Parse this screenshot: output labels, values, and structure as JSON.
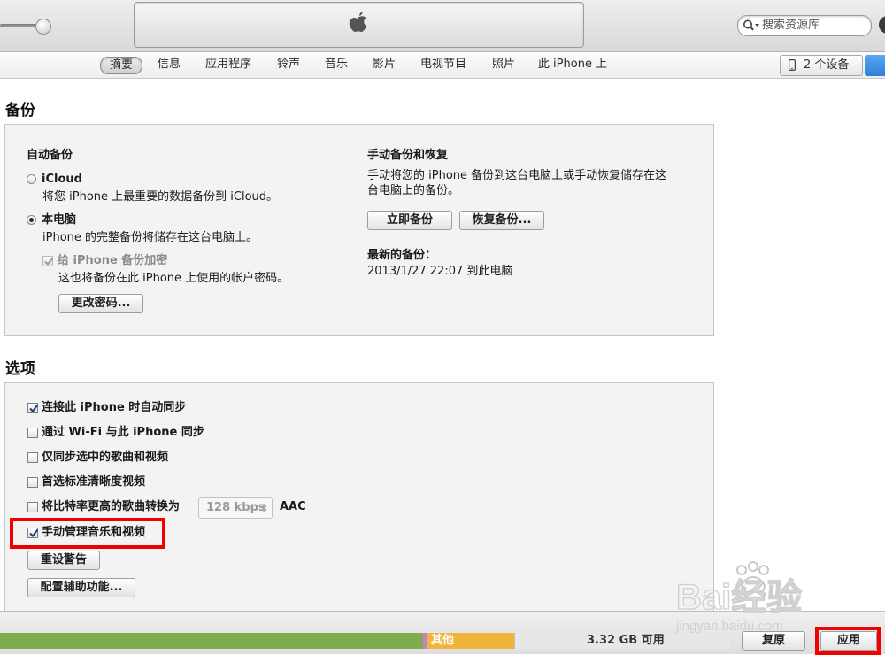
{
  "toolbar": {
    "search_placeholder": "搜索资源库"
  },
  "nav": {
    "tabs": [
      {
        "label": "摘要",
        "active": true
      },
      {
        "label": "信息"
      },
      {
        "label": "应用程序"
      },
      {
        "label": "铃声"
      },
      {
        "label": "音乐"
      },
      {
        "label": "影片"
      },
      {
        "label": "电视节目"
      },
      {
        "label": "照片"
      },
      {
        "label": "此 iPhone 上"
      }
    ],
    "devices_label": "2 个设备"
  },
  "backup": {
    "title": "备份",
    "auto_title": "自动备份",
    "icloud_label": "iCloud",
    "icloud_desc": "将您 iPhone 上最重要的数据备份到 iCloud。",
    "computer_label": "本电脑",
    "computer_desc": "iPhone 的完整备份将储存在这台电脑上。",
    "encrypt_label": "给 iPhone 备份加密",
    "encrypt_desc": "这也将备份在此 iPhone 上使用的帐户密码。",
    "change_password_button": "更改密码...",
    "manual_title": "手动备份和恢复",
    "manual_desc_line1": "手动将您的 iPhone 备份到这台电脑上或手动恢复储存在这",
    "manual_desc_line2": "台电脑上的备份。",
    "backup_now_button": "立即备份",
    "restore_backup_button": "恢复备份...",
    "latest_title": "最新的备份：",
    "latest_value": "2013/1/27  22:07 到此电脑"
  },
  "options": {
    "title": "选项",
    "auto_sync": "连接此 iPhone 时自动同步",
    "wifi_sync": "通过 Wi-Fi 与此 iPhone 同步",
    "sync_checked_only": "仅同步选中的歌曲和视频",
    "prefer_sd": "首选标准清晰度视频",
    "convert_label": "将比特率更高的歌曲转换为",
    "bitrate_value": "128 kbps",
    "codec_label": "AAC",
    "manual_manage": "手动管理音乐和视频",
    "reset_warnings_button": "重设警告",
    "accessibility_button": "配置辅助功能..."
  },
  "capacity": {
    "other_label": "其他",
    "free_label": "3.32 GB 可用",
    "colors": {
      "audio": "#7fad4e",
      "apps": "#c97fc9",
      "other": "#f0b43a",
      "free": "#e7e7e7"
    }
  },
  "footer": {
    "revert_button": "复原",
    "apply_button": "应用"
  },
  "watermark": {
    "brand": "Bai经验",
    "url": "jingyan.baidu.com"
  }
}
